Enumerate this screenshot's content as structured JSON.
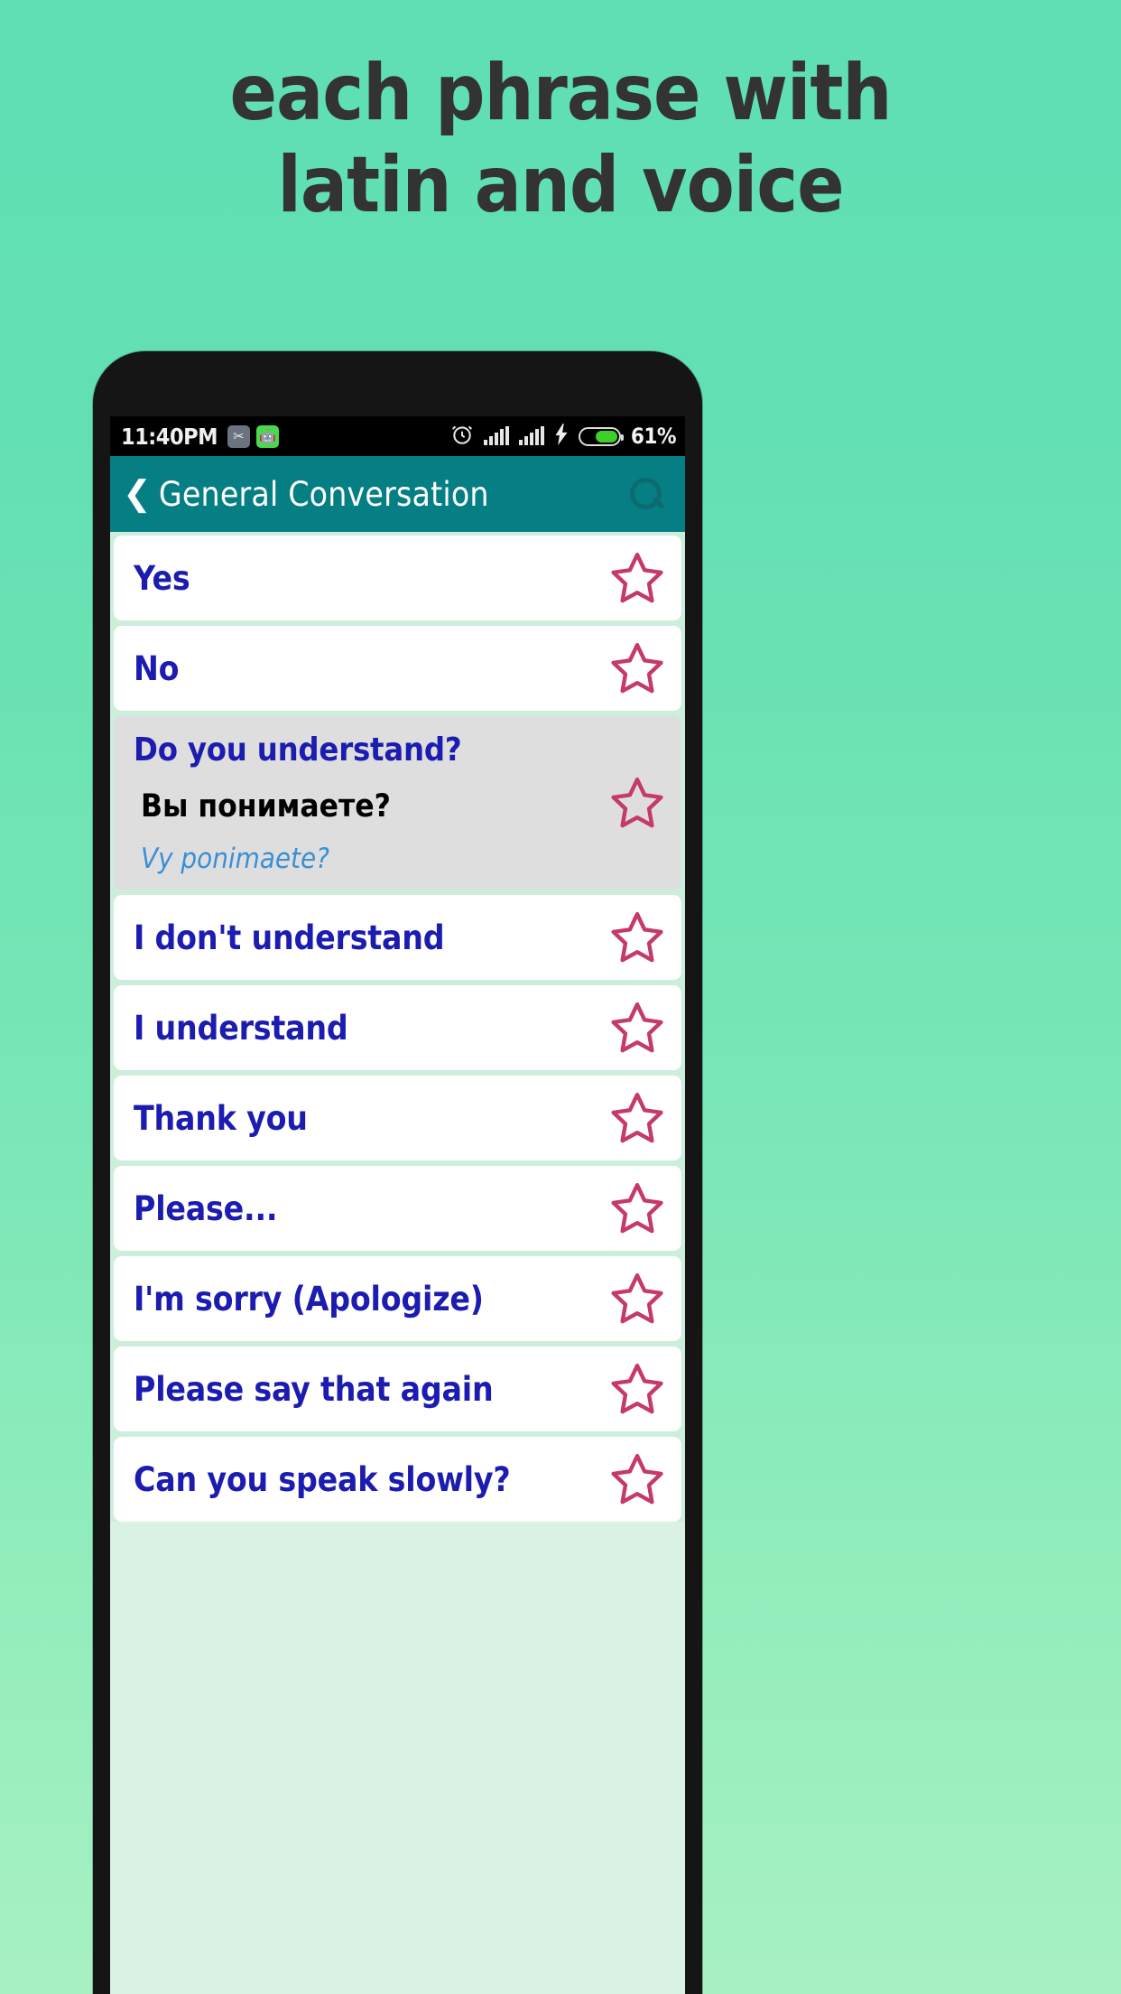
{
  "promo": {
    "line1": "each phrase with",
    "line2": "latin and voice",
    "text_color": "#333333",
    "background_top": "#5fdfb4",
    "background_bottom": "#a7f0c4"
  },
  "statusbar": {
    "time": "11:40PM",
    "battery_percent": "61%",
    "battery_level": 61,
    "icons": {
      "scissors": "scissors-app-icon",
      "robot": "android-robot-icon",
      "alarm": "alarm-clock-icon",
      "signal1": "signal-bars-icon",
      "signal2": "signal-bars-icon",
      "charging": "charging-bolt-icon",
      "battery": "battery-icon"
    }
  },
  "appbar": {
    "back_label": "❮",
    "title": "General Conversation",
    "search_label": "search-icon",
    "background": "#057f84"
  },
  "list": {
    "accent_phrase_color": "#1c1cb0",
    "star_color": "#c53a66",
    "selected_background": "#dedede",
    "rows": [
      {
        "en": "Yes",
        "selected": false
      },
      {
        "en": "No",
        "selected": false
      },
      {
        "en": "Do you understand?",
        "native": "Вы понимаете?",
        "latin": "Vy ponimaete?",
        "selected": true
      },
      {
        "en": "I don't understand",
        "selected": false
      },
      {
        "en": "I understand",
        "selected": false
      },
      {
        "en": "Thank you",
        "selected": false
      },
      {
        "en": "Please...",
        "selected": false
      },
      {
        "en": "I'm sorry (Apologize)",
        "selected": false
      },
      {
        "en": "Please say that again",
        "selected": false
      },
      {
        "en": "Can you speak slowly?",
        "selected": false
      }
    ]
  }
}
